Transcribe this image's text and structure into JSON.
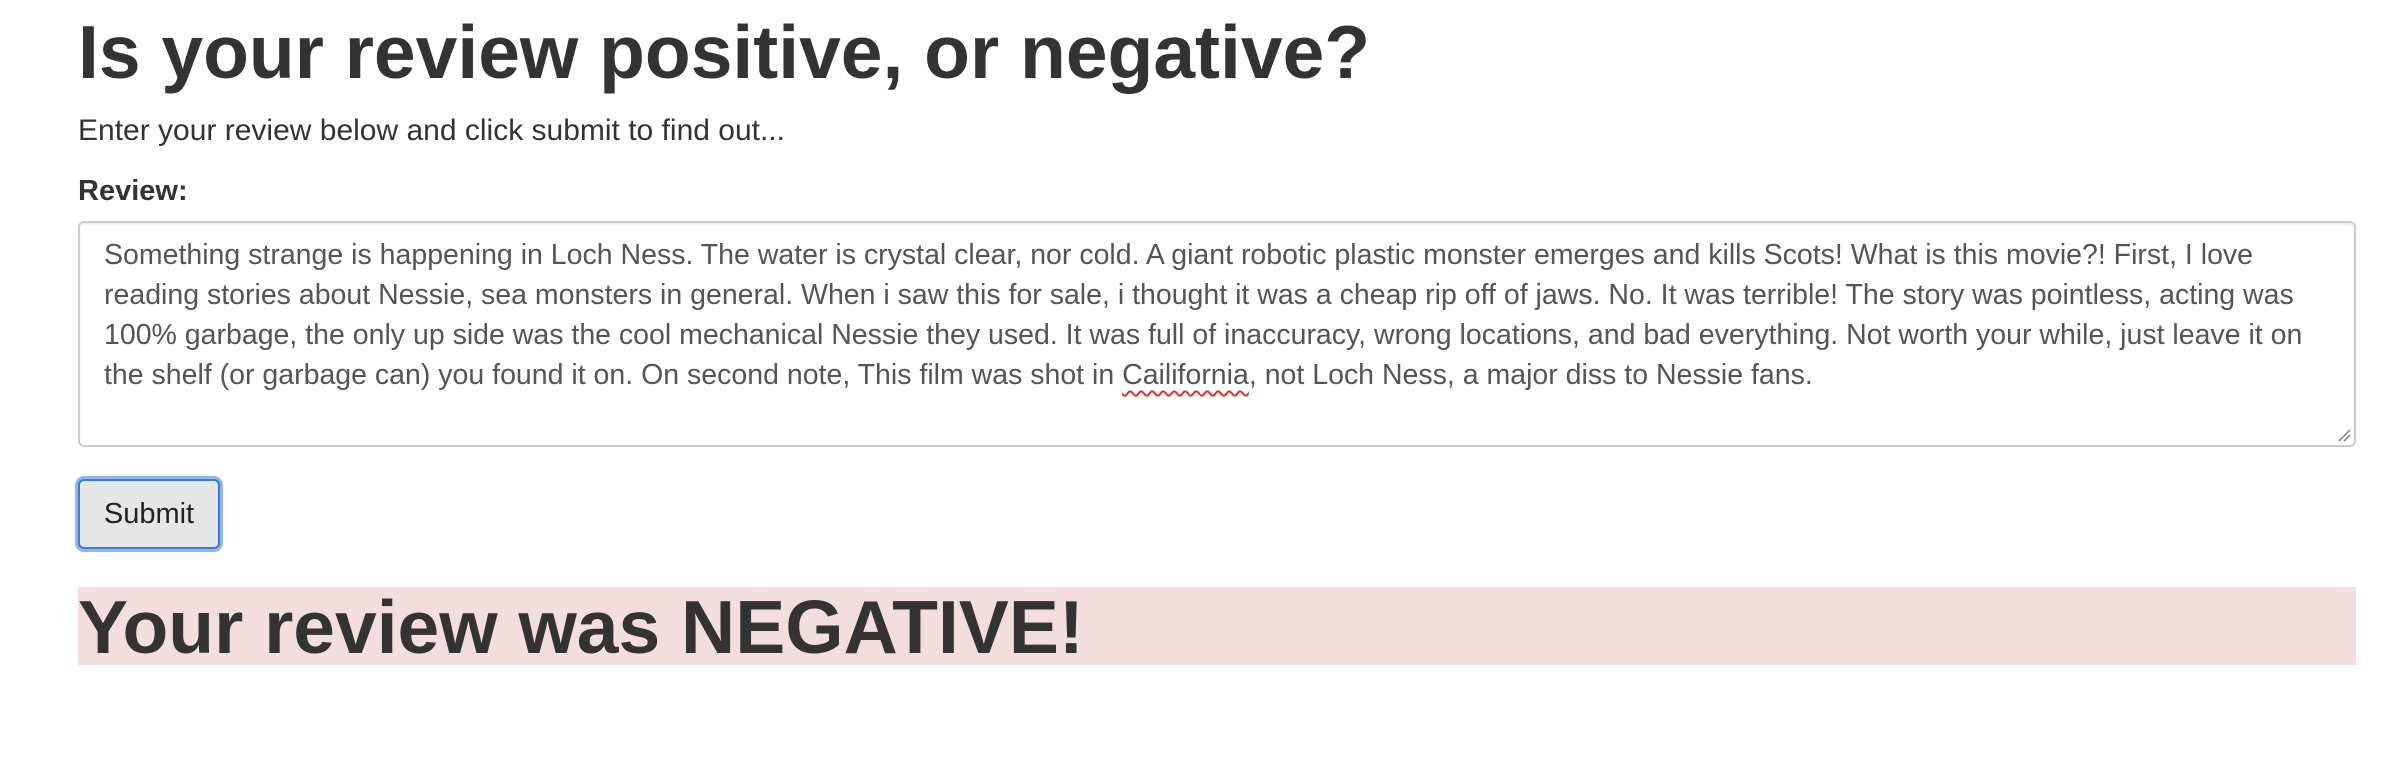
{
  "page": {
    "heading": "Is your review positive, or negative?",
    "intro": "Enter your review below and click submit to find out..."
  },
  "form": {
    "review_label": "Review:",
    "review_lines": [
      "Something strange is happening in Loch Ness. The water is crystal clear, nor cold. A giant robotic plastic monster emerges and kills Scots! What is this movie?! First, I love",
      "reading stories about Nessie, sea monsters in general. When i saw this for sale, i thought it was a cheap rip off of jaws. No. It was terrible! The story was pointless, acting was",
      "100% garbage, the only up side was the cool mechanical Nessie they used. It was full of inaccuracy, wrong locations, and bad everything. Not worth your while, just leave it on",
      {
        "before": "the shelf (or garbage can) you found it on. On second note, This film was shot in ",
        "misspelled": "Cailifornia",
        "after": ", not Loch Ness, a major diss to Nessie fans."
      }
    ],
    "submit_label": "Submit"
  },
  "result": {
    "text": "Your review was NEGATIVE!",
    "sentiment": "negative",
    "banner_color": "#f2dede"
  },
  "icons": {
    "resize_grip": "resize-grip-icon"
  }
}
